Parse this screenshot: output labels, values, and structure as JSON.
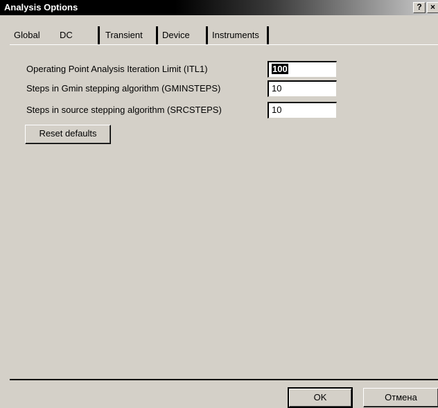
{
  "window": {
    "title": "Analysis Options",
    "help_button": "?",
    "close_button": "×"
  },
  "tabs": [
    {
      "label": "Global",
      "active": false
    },
    {
      "label": "DC",
      "active": true
    },
    {
      "label": "Transient",
      "active": false
    },
    {
      "label": "Device",
      "active": false
    },
    {
      "label": "Instruments",
      "active": false
    }
  ],
  "dc_panel": {
    "itl1": {
      "label": "Operating Point Analysis Iteration Limit (ITL1)",
      "value": "100",
      "selected": true
    },
    "gminsteps": {
      "label": "Steps in Gmin stepping algorithm (GMINSTEPS)",
      "value": "10"
    },
    "srcsteps": {
      "label": "Steps in source stepping algorithm (SRCSTEPS)",
      "value": "10"
    },
    "reset_label": "Reset defaults"
  },
  "footer": {
    "ok_label": "OK",
    "cancel_label": "Отмена"
  }
}
